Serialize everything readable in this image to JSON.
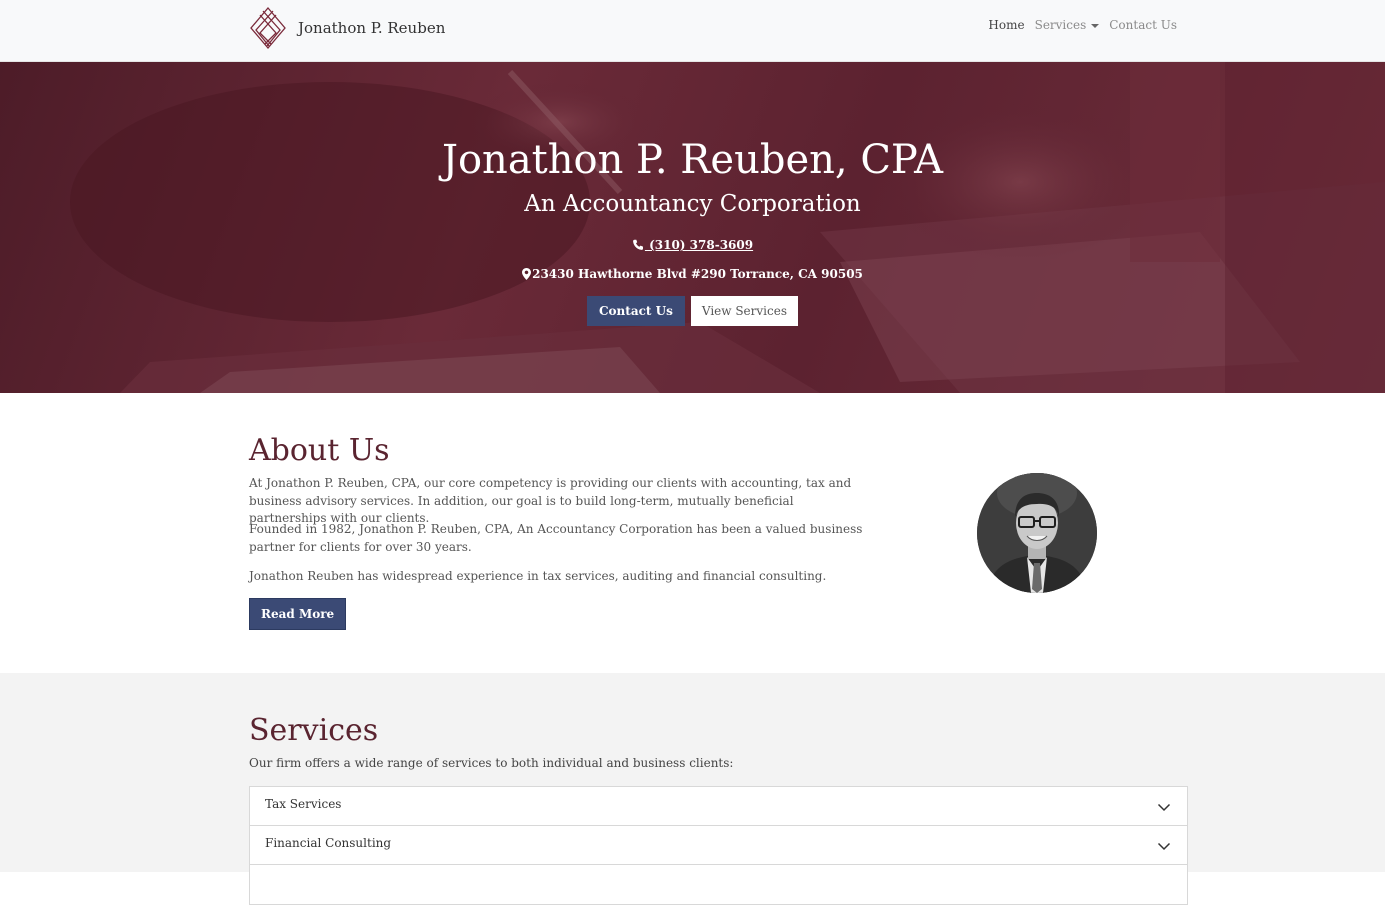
{
  "navbar": {
    "brand_name": "Jonathon P. Reuben",
    "links": [
      {
        "label": "Home"
      },
      {
        "label": "Services"
      },
      {
        "label": "Contact Us"
      }
    ]
  },
  "hero": {
    "title": "Jonathon P. Reuben, CPA",
    "subtitle": "An Accountancy Corporation",
    "phone": " (310) 378-3609",
    "address": "23430 Hawthorne Blvd #290 Torrance, CA 90505",
    "contact_button": "Contact Us",
    "services_button": "View Services"
  },
  "about": {
    "title": "About Us",
    "paragraphs": [
      "At Jonathon P. Reuben, CPA, our core competency is providing our clients with accounting, tax and business advisory services. In addition, our goal is to build long-term, mutually beneficial partnerships with our clients.",
      "Founded in 1982, Jonathon P. Reuben, CPA, An Accountancy Corporation has been a valued business partner for clients for over 30 years.",
      "Jonathon Reuben has widespread experience in tax services, auditing and financial consulting."
    ],
    "read_more": "Read More"
  },
  "services": {
    "title": "Services",
    "intro": "Our firm offers a wide range of services to both individual and business clients:",
    "items": [
      {
        "label": "Tax Services"
      },
      {
        "label": "Financial Consulting"
      },
      {
        "label": ""
      }
    ]
  },
  "colors": {
    "accent_maroon": "#5a2430",
    "button_navy": "#3b4a75",
    "hero_overlay": "#5c2230"
  }
}
